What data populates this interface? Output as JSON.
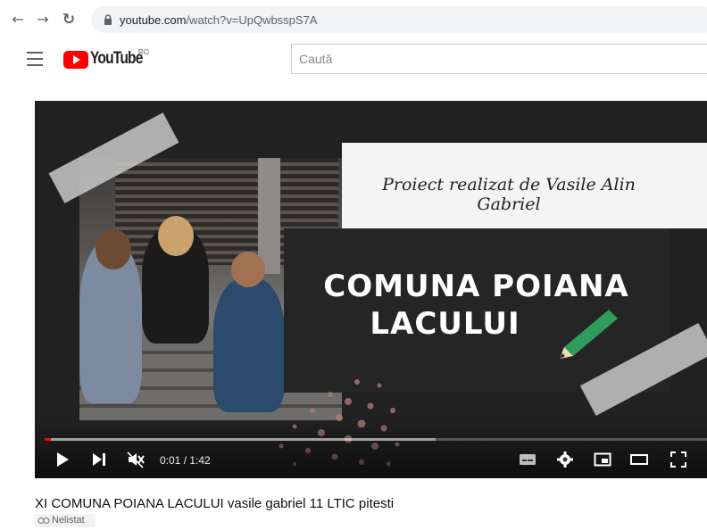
{
  "browser": {
    "url_domain": "youtube.com",
    "url_path": "/watch?v=UpQwbsspS7A",
    "icons": [
      "back-arrow-icon",
      "forward-arrow-icon",
      "reload-icon",
      "lock-icon"
    ]
  },
  "masthead": {
    "logo_text": "YouTube",
    "country_code": "RO",
    "search_placeholder": "Caută"
  },
  "video": {
    "byline": "Proiect realizat de Vasile Alin Gabriel",
    "slide_title_line1": "COMUNA POIANA",
    "slide_title_line2": "LACULUI",
    "time_current": "0:01",
    "time_total": "1:42",
    "progress_fraction": 0.01,
    "buffered_fraction": 0.59,
    "title": "XI COMUNA POIANA LACULUI vasile gabriel 11 LTIC pitesti",
    "visibility_badge": "Nelistat"
  },
  "colors": {
    "youtube_red": "#ff0000",
    "player_bg": "#212121",
    "pencil_green": "#2e9c5a"
  }
}
